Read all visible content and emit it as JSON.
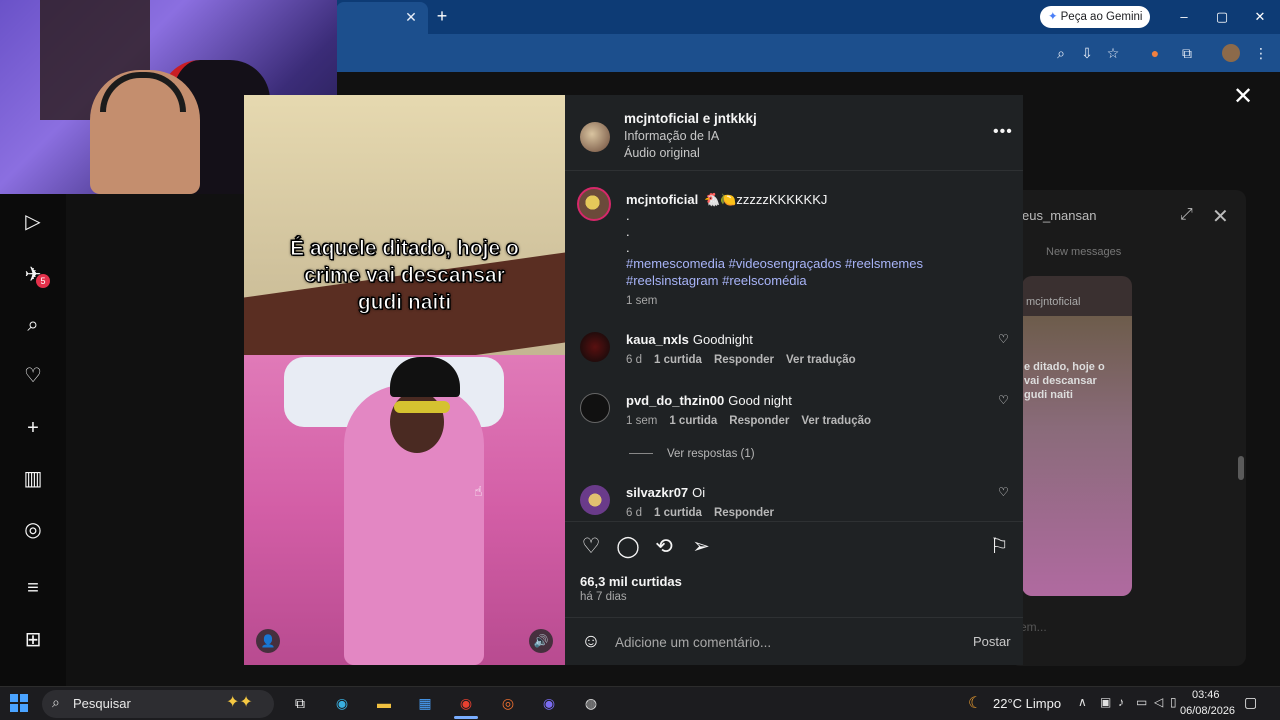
{
  "browser": {
    "new_tab": "+",
    "tab_close": "✕",
    "gemini_button": "Peça ao Gemini",
    "win_min": "–",
    "win_max": "▢",
    "win_close": "✕",
    "toolbar_icons": [
      "zoom-icon",
      "install-icon",
      "bookmark-star-icon",
      "extension-icon",
      "puzzle-icon",
      "profile-avatar",
      "menu-icon"
    ]
  },
  "sidebar": {
    "items": [
      "reels-icon",
      "messages-icon",
      "search-icon",
      "notifications-icon",
      "create-icon",
      "dashboard-icon",
      "threads-icon",
      "more-icon",
      "apps-icon"
    ],
    "messages_badge": "5"
  },
  "background": {
    "dm_user": "eus_mansan",
    "dm_new_messages": "New messages",
    "dm_card_user": "mcjntoficial",
    "dm_card_caption": "e ditado, hoje o\nvai descansar\ngudi naiti",
    "dm_message_placeholder": "em..."
  },
  "modal": {
    "close": "✕"
  },
  "video": {
    "caption": "É aquele ditado, hoje o\ncrime vai descansar\ngudi naiti"
  },
  "header": {
    "username": "mcjntoficial e jntkkkj",
    "ai_info": "Informação de IA",
    "audio": "Áudio original",
    "more": "•••"
  },
  "caption": {
    "username": "mcjntoficial",
    "text": "🐔🍋zzzzzKKKKKKJ",
    "dots": [
      ".",
      ".",
      "."
    ],
    "tags_line1": "#memescomedia #videosengraçados #reelsmemes",
    "tags_line2": "#reelsinstagram #reelscomédia",
    "time": "1 sem"
  },
  "comments": [
    {
      "user": "kaua_nxls",
      "text": "Goodnight",
      "time": "6 d",
      "likes": "1 curtida",
      "reply": "Responder",
      "translate": "Ver tradução"
    },
    {
      "user": "pvd_do_thzin00",
      "text": "Good night",
      "time": "1 sem",
      "likes": "1 curtida",
      "reply": "Responder",
      "translate": "Ver tradução"
    },
    {
      "user": "silvazkr07",
      "text": "Oi",
      "time": "6 d",
      "likes": "1 curtida",
      "reply": "Responder",
      "translate": ""
    }
  ],
  "view_replies": "Ver respostas (1)",
  "actions": {
    "likes": "66,3 mil curtidas",
    "posted": "há 7 dias"
  },
  "compose": {
    "placeholder": "Adicione um comentário...",
    "post": "Postar"
  },
  "taskbar": {
    "search": "Pesquisar",
    "weather": "22°C  Limpo",
    "time": "03:46",
    "date": "06/08/2026"
  },
  "colors": {
    "panel_bg": "#1f2224",
    "hashtag": "#a8b4f8",
    "chrome_tabbar": "#0d3b75",
    "chrome_toolbar": "#1c4f8d"
  }
}
